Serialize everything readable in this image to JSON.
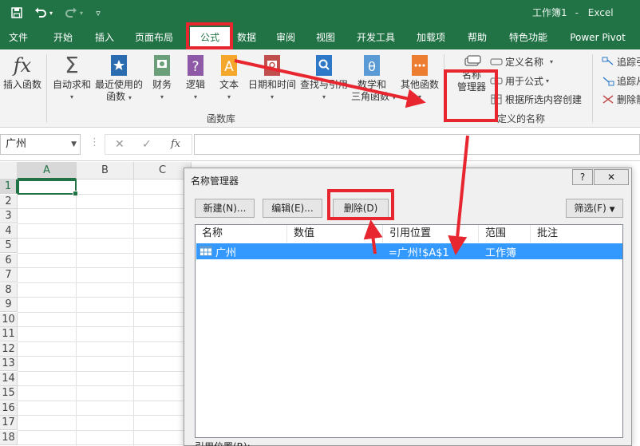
{
  "titlebar": {
    "doc_name": "工作簿1",
    "app_name": "Excel"
  },
  "tabs": [
    "文件",
    "开始",
    "插入",
    "页面布局",
    "公式",
    "数据",
    "审阅",
    "视图",
    "开发工具",
    "加载项",
    "帮助",
    "特色功能",
    "Power Pivot"
  ],
  "active_tab": "公式",
  "ribbon": {
    "insert_function": "插入函数",
    "autosum": "自动求和",
    "recent_1": "最近使用的",
    "recent_2": "函数",
    "financial": "财务",
    "logical": "逻辑",
    "text": "文本",
    "datetime": "日期和时间",
    "lookup": "查找与引用",
    "math_1": "数学和",
    "math_2": "三角函数",
    "other": "其他函数",
    "name_manager_1": "名称",
    "name_manager_2": "管理器",
    "define_name": "定义名称",
    "use_in_formula": "用于公式",
    "create_from_selection": "根据所选内容创建",
    "group_function_library": "函数库",
    "group_defined_names": "定义的名称",
    "trace_precedents": "追踪引",
    "trace_dependents": "追踪从",
    "remove_arrows": "删除箭"
  },
  "formula_bar": {
    "name_box": "广州",
    "fx": "fx"
  },
  "grid": {
    "columns": [
      "A",
      "B",
      "C"
    ],
    "rows": [
      "1",
      "2",
      "3",
      "4",
      "5",
      "6",
      "7",
      "8",
      "9",
      "10",
      "11",
      "12",
      "13",
      "14",
      "15",
      "16",
      "17",
      "18"
    ]
  },
  "dialog": {
    "title": "名称管理器",
    "help": "?",
    "new_button": "新建(N)...",
    "edit_button": "编辑(E)...",
    "delete_button": "删除(D)",
    "filter_button": "筛选(F)",
    "columns": [
      "名称",
      "数值",
      "引用位置",
      "范围",
      "批注"
    ],
    "rows": [
      {
        "name": "广州",
        "value": "",
        "refers_to": "=广州!$A$1",
        "scope": "工作簿",
        "comment": ""
      }
    ],
    "refers_to_label": "引用位置(R):"
  },
  "colors": {
    "excel_green": "#217346",
    "selection_blue": "#3399ff",
    "annotation_red": "#e8262f"
  }
}
